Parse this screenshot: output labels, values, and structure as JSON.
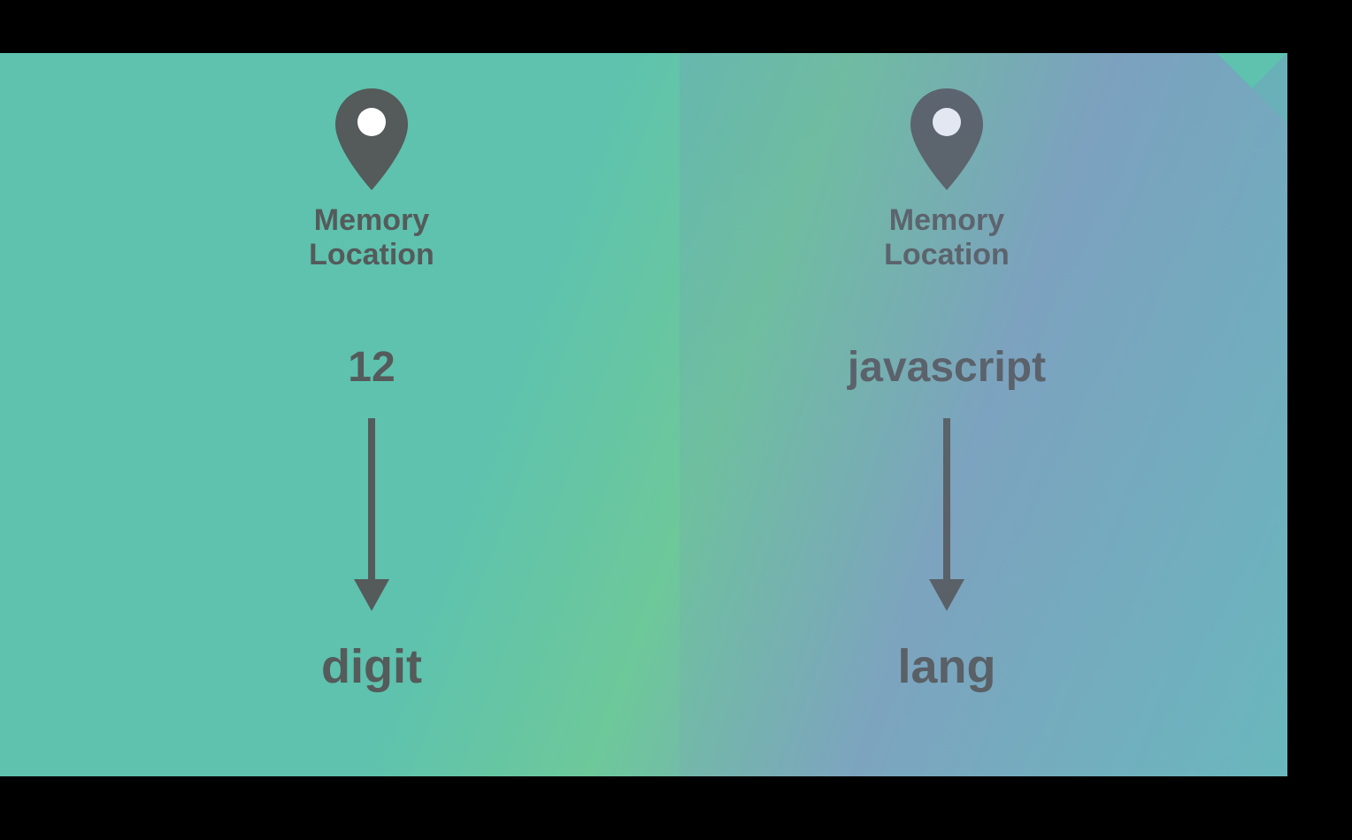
{
  "left": {
    "memLine1": "Memory",
    "memLine2": "Location",
    "value": "12",
    "variable": "digit"
  },
  "right": {
    "memLine1": "Memory",
    "memLine2": "Location",
    "value": "javascript",
    "variable": "lang"
  }
}
